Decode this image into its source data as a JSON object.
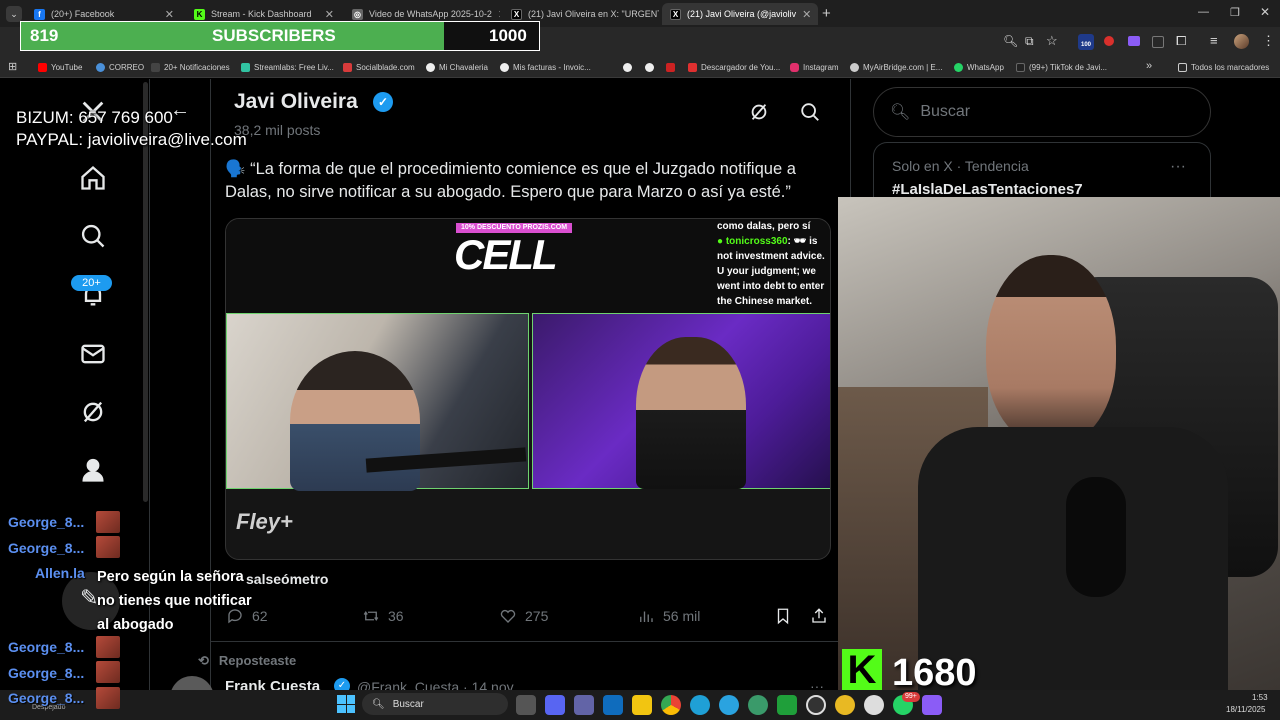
{
  "browser": {
    "tabs": [
      {
        "label": "(20+) Facebook",
        "color": "#1877f2",
        "glyph": "f"
      },
      {
        "label": "Stream - Kick Dashboard",
        "color": "#53fc18",
        "glyph": "K"
      },
      {
        "label": "Video de WhatsApp 2025-10-2",
        "color": "#888888",
        "glyph": "◎"
      },
      {
        "label": "(21) Javi Oliveira en X: \"URGENT",
        "color": "#333333",
        "glyph": "X"
      },
      {
        "label": "(21) Javi Oliveira (@javioliv",
        "color": "#333333",
        "glyph": "X"
      }
    ],
    "new_tab": "+",
    "bookmarks": [
      {
        "label": "YouTube",
        "color": "#ff0000"
      },
      {
        "label": "CORREO",
        "color": "#4a90d9"
      },
      {
        "label": "20+ Notificaciones",
        "color": "#444444"
      },
      {
        "label": "Streamlabs: Free Liv...",
        "color": "#31c3a2"
      },
      {
        "label": "Socialblade.com",
        "color": "#d83b3b"
      },
      {
        "label": "Mi Chavaleria",
        "color": "#eeeeee"
      },
      {
        "label": "Mis facturas - Invoic...",
        "color": "#eeeeee"
      },
      {
        "label": "",
        "color": "#eeeeee"
      },
      {
        "label": "",
        "color": "#cc2222"
      },
      {
        "label": "Descargador de You...",
        "color": "#e03030"
      },
      {
        "label": "Instagram",
        "color": "#e1306c"
      },
      {
        "label": "MyAirBridge.com | E...",
        "color": "#cccccc"
      },
      {
        "label": "WhatsApp",
        "color": "#25d366"
      },
      {
        "label": "(99+) TikTok de Javi...",
        "color": "#222222"
      }
    ],
    "more_bookmarks": "»",
    "all_bookmarks": "Todos los marcadores",
    "ext_badge": "100"
  },
  "overlay": {
    "sub_current": "819",
    "sub_label": "SUBSCRIBERS",
    "sub_goal": "1000",
    "sub_progress": 0.819,
    "bizum": "BIZUM: 657 769 600",
    "paypal": "PAYPAL: javioliveira@live.com",
    "kick_count": "1680"
  },
  "x": {
    "notif_badge": "20+",
    "profile_name": "Javi Oliveira",
    "post_count": "38,2 mil posts",
    "quote": "🗣️ “La forma de que el procedimiento comience es que el Juzgado notifique a Dalas, no sirve notificar a su abogado. Espero que para Marzo o así ya esté.”",
    "media_banner": "10% DESCUENTO PROZIS.COM",
    "media_cell": "CELL",
    "media_chat1": "como dalas, pero sí",
    "media_chat_user": "tonicross360",
    "media_chat2": ": 🕶 is not investment advice. U your judgment; we went into debt to enter the Chinese market.",
    "media_logo": "Fley+",
    "card_title": "salseómetro",
    "replies": "62",
    "reposts": "36",
    "likes": "275",
    "views": "56 mil",
    "repost_label": "Reposteaste",
    "next_name": "Frank Cuesta",
    "next_handle": "@Frank_Cuesta · 14 nov"
  },
  "sidebar": {
    "search_placeholder": "Buscar",
    "trend_meta": "Solo en X · Tendencia",
    "trend_tag": "#LaIslaDeLasTentaciones7",
    "trend_more": "···"
  },
  "chat": [
    {
      "name": "George_8...",
      "text": ""
    },
    {
      "name": "George_8...",
      "text": ""
    },
    {
      "name": "Allen.la",
      "text": "Pero según la señora no tienes que notificar al abogado"
    },
    {
      "name": "George_8...",
      "text": ""
    },
    {
      "name": "George_8...",
      "text": ""
    },
    {
      "name": "George_8...",
      "text": ""
    }
  ],
  "taskbar": {
    "search": "Buscar",
    "weather": "Despejado",
    "time": "1:53",
    "date": "18/11/2025",
    "wa_badge": "99+"
  }
}
